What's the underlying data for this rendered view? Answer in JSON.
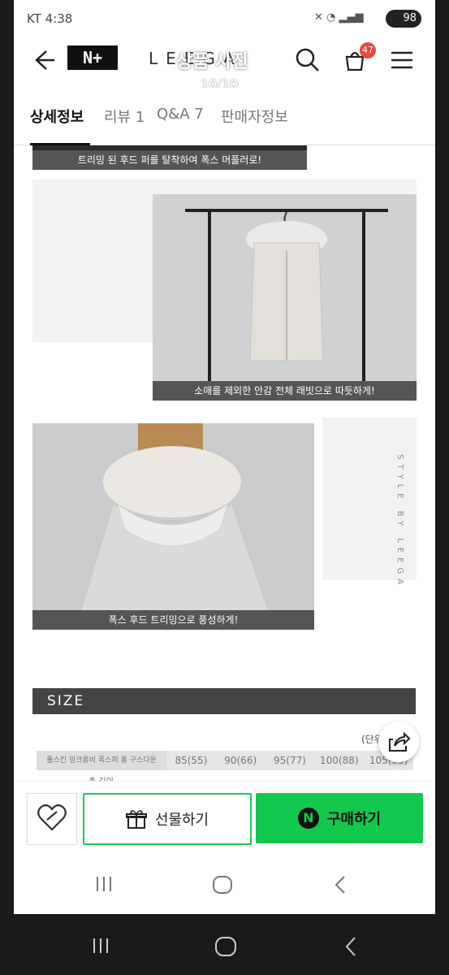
{
  "status_bar": {
    "carrier": "KT 4:38",
    "battery": "98"
  },
  "header": {
    "logo": "N+",
    "brand": "LEEGA",
    "overlay_title": "상품 사진",
    "overlay_counter": "10/10",
    "cart_count": "47"
  },
  "tabs": [
    {
      "label": "상세정보",
      "active": true
    },
    {
      "label": "리뷰 1",
      "active": false
    },
    {
      "label": "Q&A 7",
      "active": false
    },
    {
      "label": "판매자정보",
      "active": false
    }
  ],
  "content": {
    "caption_top": "트리밍 된 후드 퍼를 탈착하여 폭스 머플러로!",
    "caption_vest": "소매를 제외한 안감 전체 래빗으로 따듯하게!",
    "caption_hood": "폭스 후드 트리밍으로 풍성하게!",
    "side_text": "STYLE BY LEEGA",
    "size_title": "SIZE",
    "unit_label": "(단위",
    "size_table": {
      "first_header": "풀스킨 밍크롱비 폭스퍼 롱 구스다운",
      "sizes": [
        "85(55)",
        "90(66)",
        "95(77)",
        "100(88)",
        "105(99)"
      ],
      "next_row_label": "총 길이"
    }
  },
  "bottom_bar": {
    "gift_label": "선물하기",
    "buy_label": "구매하기"
  },
  "colors": {
    "buy_green": "#12c94e",
    "badge_red": "#e8483c",
    "caption_gray": "#555555"
  }
}
